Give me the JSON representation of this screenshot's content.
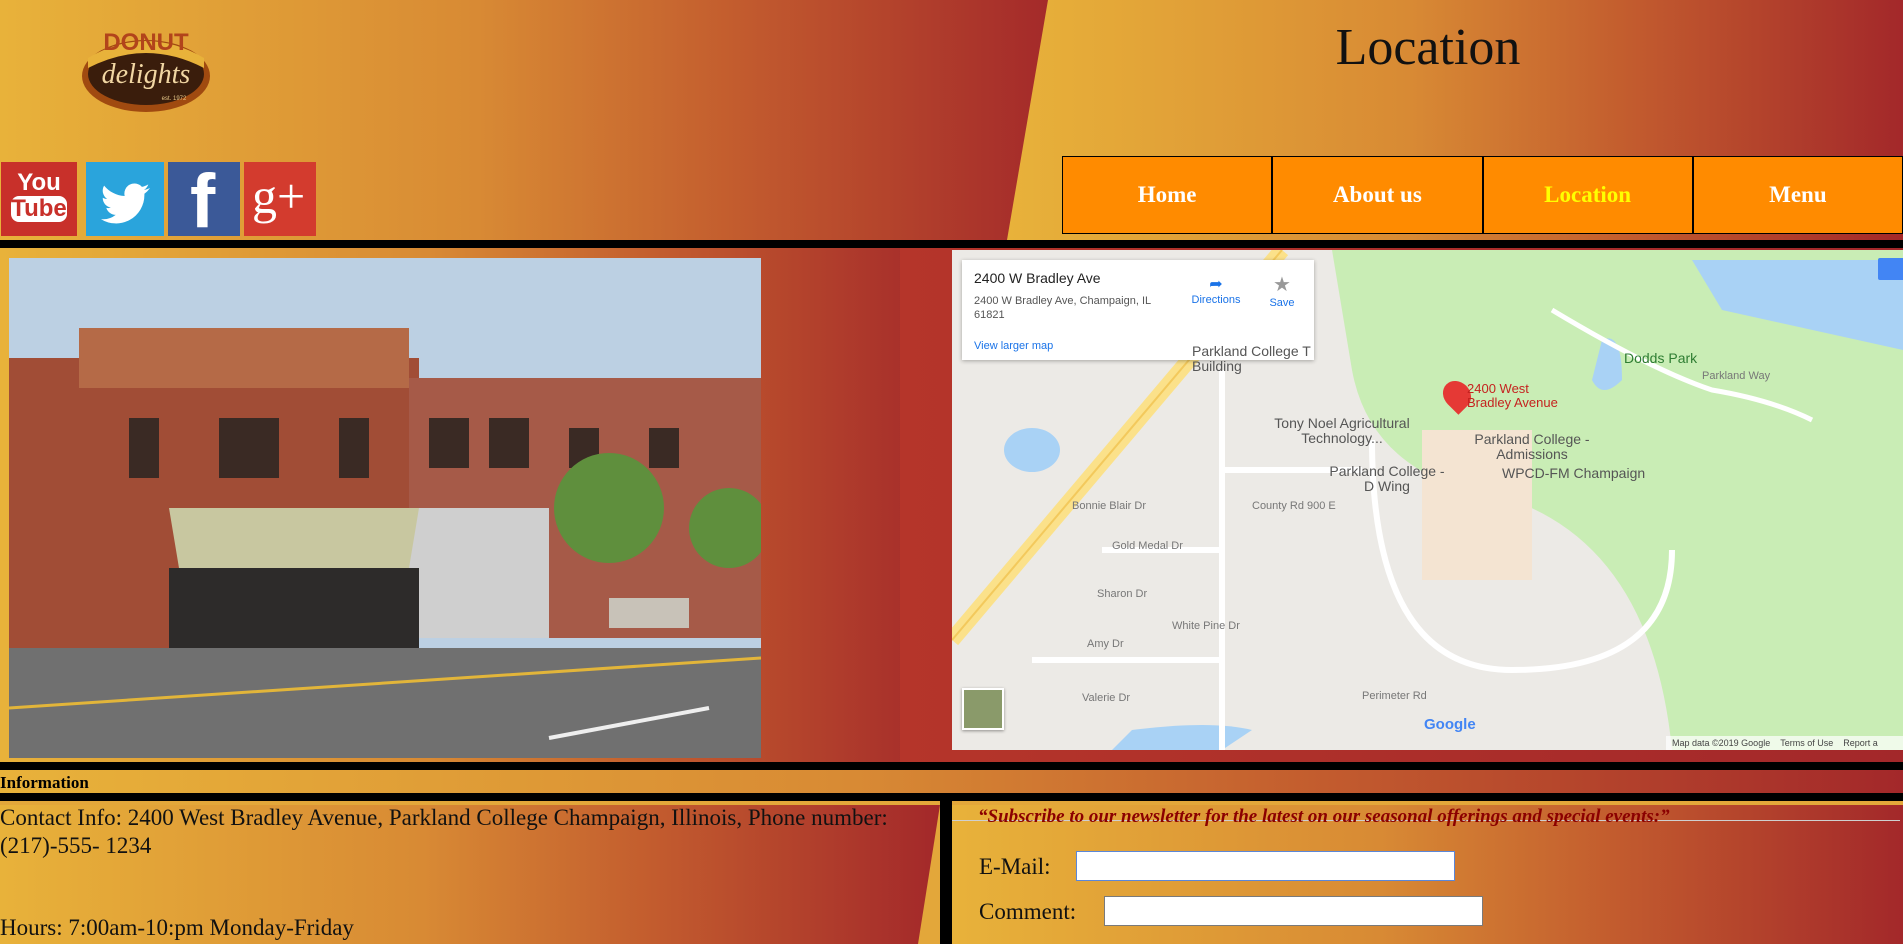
{
  "header": {
    "title": "Location",
    "logo": {
      "top_text": "DONUT",
      "script_text": "delights",
      "est": "est. 1972"
    }
  },
  "social": [
    {
      "name": "youtube",
      "label_top": "You",
      "label_bottom": "Tube"
    },
    {
      "name": "twitter",
      "glyph": "bird"
    },
    {
      "name": "facebook",
      "glyph": "f"
    },
    {
      "name": "googleplus",
      "glyph": "g+"
    }
  ],
  "nav": [
    {
      "label": "Home",
      "active": false
    },
    {
      "label": "About us",
      "active": false
    },
    {
      "label": "Location",
      "active": true
    },
    {
      "label": "Menu",
      "active": false
    }
  ],
  "map": {
    "card_title": "2400 W Bradley Ave",
    "card_address": "2400 W Bradley Ave, Champaign, IL 61821",
    "card_link": "View larger map",
    "directions": "Directions",
    "save": "Save",
    "pin_label_1": "2400 West",
    "pin_label_2": "Bradley Avenue",
    "labels": [
      "Parkland College T Building",
      "Dodds Park",
      "Tony Noel Agricultural Technology...",
      "Parkland College - Admissions",
      "Parkland College - D Wing",
      "WPCD-FM Champaign",
      "Gold Medal Dr",
      "Sharon Dr",
      "Amy Dr",
      "Valerie Dr",
      "Perimeter Rd",
      "Parkland Way",
      "County Rd 900 E",
      "White Pine Dr",
      "Bonnie Blair Dr"
    ],
    "brand": "Google",
    "footer_data": "Map data ©2019 Google",
    "footer_terms": "Terms of Use",
    "footer_report": "Report a"
  },
  "info": {
    "label": "Information",
    "contact": "Contact Info: 2400 West Bradley Avenue, Parkland College Champaign, Illinois, Phone number: (217)-555- 1234",
    "hours": "Hours: 7:00am-10:pm Monday-Friday"
  },
  "newsletter": {
    "legend": "“Subscribe to our newsletter for the latest on our seasonal offerings and special events:”",
    "email_label": "E-Mail:",
    "comment_label": "Comment:",
    "email_value": "",
    "comment_value": ""
  },
  "colors": {
    "nav_bg": "#ff8b00",
    "nav_active_text": "#ffff00",
    "legend_text": "#8b0000",
    "gradient_start": "#e8b23a",
    "gradient_end": "#a3282a"
  }
}
